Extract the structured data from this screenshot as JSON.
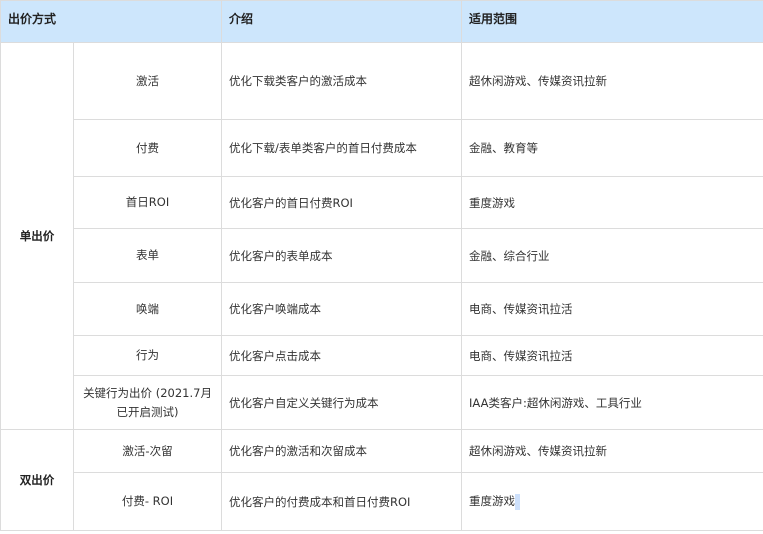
{
  "header": {
    "method": "出价方式",
    "intro": "介绍",
    "scope": "适用范围"
  },
  "groups": [
    {
      "label": "单出价",
      "rows": [
        {
          "method": "激活",
          "intro": "优化下载类客户的激活成本",
          "scope": "超休闲游戏、传媒资讯拉新"
        },
        {
          "method": "付费",
          "intro": "优化下载/表单类客户的首日付费成本",
          "scope": "金融、教育等"
        },
        {
          "method": "首日ROI",
          "intro": "优化客户的首日付费ROI",
          "scope": "重度游戏"
        },
        {
          "method": "表单",
          "intro": "优化客户的表单成本",
          "scope": "金融、综合行业"
        },
        {
          "method": "唤端",
          "intro": "优化客户唤端成本",
          "scope": "电商、传媒资讯拉活"
        },
        {
          "method": "行为",
          "intro": "优化客户点击成本",
          "scope": "电商、传媒资讯拉活"
        },
        {
          "method": "关键行为出价 (2021.7月已开启测试)",
          "intro": "优化客户自定义关键行为成本",
          "scope": "IAA类客户:超休闲游戏、工具行业"
        }
      ]
    },
    {
      "label": "双出价",
      "rows": [
        {
          "method": "激活-次留",
          "intro": "优化客户的激活和次留成本",
          "scope": "超休闲游戏、传媒资讯拉新"
        },
        {
          "method": "付费- ROI",
          "intro": "优化客户的付费成本和首日付费ROI",
          "scope": "重度游戏"
        }
      ]
    }
  ]
}
